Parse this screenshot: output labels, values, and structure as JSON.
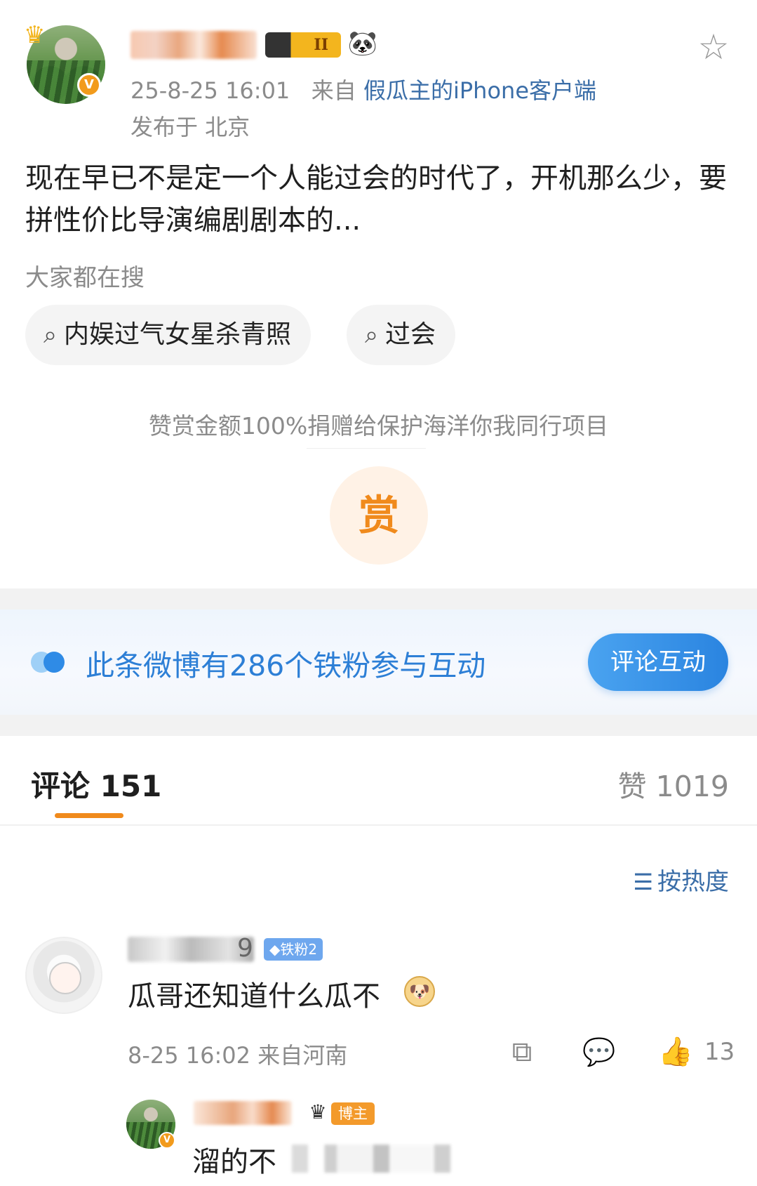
{
  "post": {
    "time": "25-8-25 16:01",
    "from_prefix": "来自",
    "source": "假瓜主的iPhone客户端",
    "location": "发布于 北京",
    "level_badge": "II",
    "text": "现在早已不是定一个人能过会的时代了，开机那么少，要拼性价比导演编剧剧本的...",
    "icons": [
      "crown-icon",
      "verified-icon",
      "panda-icon",
      "star-icon"
    ]
  },
  "search": {
    "label": "大家都在搜",
    "chips": [
      "内娱过气女星杀青照",
      "过会"
    ]
  },
  "reward": {
    "text": "赞赏金额100%捐赠给保护海洋你我同行项目",
    "button": "赏"
  },
  "fans": {
    "text": "此条微博有286个铁粉参与互动",
    "button": "评论互动"
  },
  "tabs": {
    "comments": "评论 151",
    "likes": "赞 1019",
    "accent_color": "#f08a1c"
  },
  "sort": {
    "label": "按热度"
  },
  "comment": {
    "username_tail": "9",
    "fan_badge": "◆铁粉2",
    "text": "瓜哥还知道什么瓜不",
    "meta": "8-25 16:02 来自河南",
    "likes": "13"
  },
  "reply": {
    "badge": "博主",
    "text": "溜的不"
  }
}
